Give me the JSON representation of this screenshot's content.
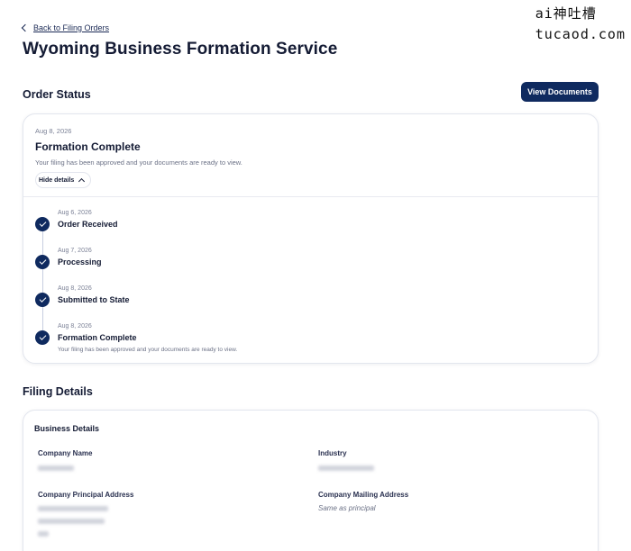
{
  "watermark": {
    "line1": "ai神吐槽",
    "line2": "tucaod.com"
  },
  "nav": {
    "back_label": "Back to Filing Orders"
  },
  "page": {
    "title": "Wyoming Business Formation Service"
  },
  "order_status": {
    "section_title": "Order Status",
    "view_documents_label": "View Documents",
    "current": {
      "date": "Aug 8, 2026",
      "title": "Formation Complete",
      "description": "Your filing has been approved and your documents are ready to view.",
      "toggle_label": "Hide details"
    },
    "steps": [
      {
        "date": "Aug 6, 2026",
        "title": "Order Received",
        "description": ""
      },
      {
        "date": "Aug 7, 2026",
        "title": "Processing",
        "description": ""
      },
      {
        "date": "Aug 8, 2026",
        "title": "Submitted to State",
        "description": ""
      },
      {
        "date": "Aug 8, 2026",
        "title": "Formation Complete",
        "description": "Your filing has been approved and your documents are ready to view."
      }
    ]
  },
  "filing_details": {
    "section_title": "Filing Details",
    "card_title": "Business Details",
    "fields": {
      "company_name_label": "Company Name",
      "industry_label": "Industry",
      "principal_address_label": "Company Principal Address",
      "mailing_address_label": "Company Mailing Address",
      "mailing_address_value": "Same as principal"
    }
  },
  "colors": {
    "primary": "#0f2a5f",
    "text": "#141b34",
    "muted": "#6b7186",
    "border": "#e3e6ee"
  }
}
